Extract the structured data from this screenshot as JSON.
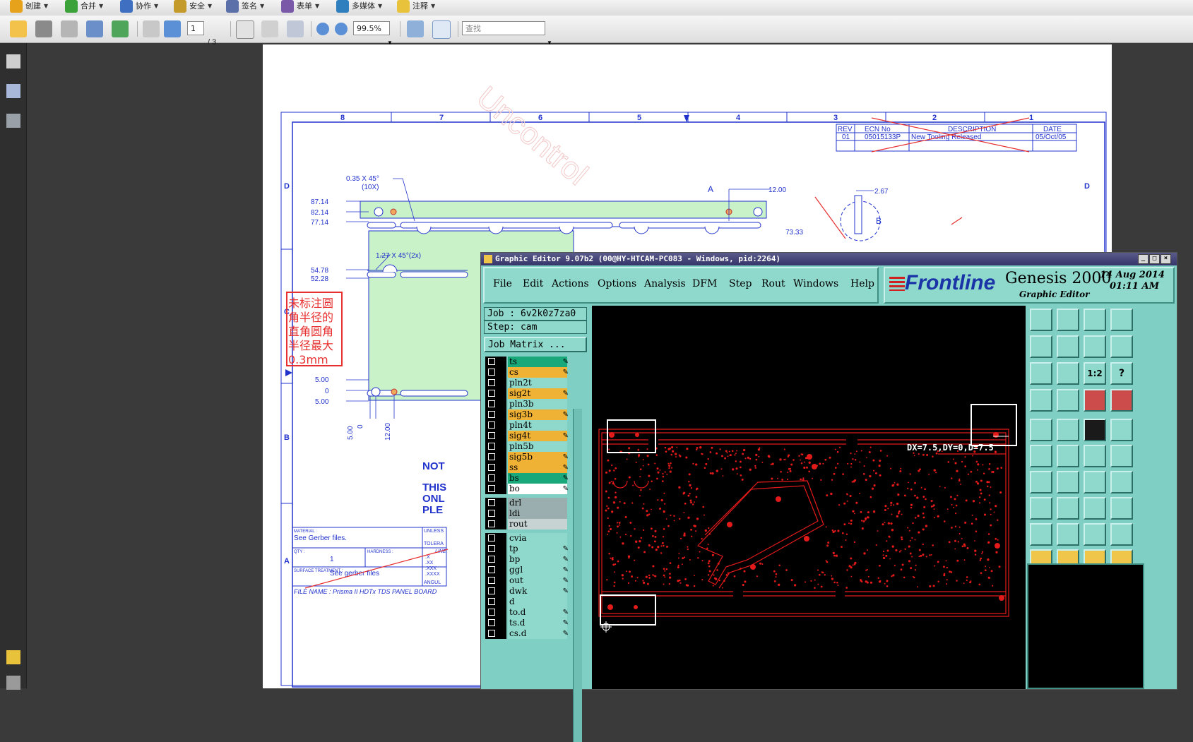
{
  "menubar": {
    "items": [
      {
        "label": "创建",
        "icon": "create-icon",
        "color": "#e7a21b"
      },
      {
        "label": "合并",
        "icon": "combine-icon",
        "color": "#3aa238"
      },
      {
        "label": "协作",
        "icon": "collaborate-icon",
        "color": "#3f6fc0"
      },
      {
        "label": "安全",
        "icon": "lock-icon",
        "color": "#c49a2b"
      },
      {
        "label": "签名",
        "icon": "pen-icon",
        "color": "#5b6fa8"
      },
      {
        "label": "表单",
        "icon": "form-icon",
        "color": "#7a5aa8"
      },
      {
        "label": "多媒体",
        "icon": "film-icon",
        "color": "#2f7fbf"
      },
      {
        "label": "注释",
        "icon": "comment-icon",
        "color": "#e8c23a"
      }
    ]
  },
  "toolbar": {
    "page_current": "1",
    "page_total": "/ 3",
    "zoom": "99.5%",
    "search_placeholder": "查找"
  },
  "drawing": {
    "col_labels": [
      "8",
      "7",
      "6",
      "5",
      "4",
      "3",
      "2",
      "1"
    ],
    "row_labels": [
      "D",
      "C",
      "B",
      "A"
    ],
    "rev_header": [
      "REV",
      "ECN No",
      "DESCRIPTION",
      "DATE"
    ],
    "rev_row": [
      "01",
      "05015133P",
      "New Tooling Released",
      "05/Oct/05"
    ],
    "watermark": "Uncontrol",
    "dim_chamfer_top": "0.35 X 45°",
    "dim_chamfer_count": "(10X)",
    "dim_chamfer_side": "1.27 X 45°(2x)",
    "dims_left": [
      "87.14",
      "82.14",
      "77.14",
      "54.78",
      "52.28",
      "5.00",
      "0",
      "5.00"
    ],
    "dims_bottom": [
      "5.00",
      "0",
      "12.00"
    ],
    "dim_a": "A",
    "dim_1200": "12.00",
    "dim_267": "2.67",
    "dim_b": "B",
    "dim_7333": "73.33",
    "note_lines": [
      "未标注圆",
      "角半径的",
      "直角圆角",
      "半径最大",
      "0.3mm"
    ],
    "note_right": [
      "NOT",
      "THIS",
      "ONL",
      "PLE"
    ],
    "title_block": {
      "material_label": "MATERIAL :",
      "material": "See Gerber files.",
      "qty_label": "QTY :",
      "qty": "1",
      "hardness_label": "HARDNESS :",
      "surface_label": "SURFACE TREATMENT :",
      "surface": "See gerber files",
      "unless": "UNLESS",
      "tolera": "TOLERA",
      "line": "LINE",
      "x1": ".X",
      "x2": ".XX",
      "x3": ".XXX",
      "x4": ".XXXX",
      "angul": "ANGUL",
      "file_name": "FILE NAME : Prisma II HDTx TDS PANEL BOARD"
    }
  },
  "genesis": {
    "title": "Graphic Editor 9.07b2 (00@HY-HTCAM-PC083 - Windows, pid:2264)",
    "menu": [
      "File",
      "Edit",
      "Actions",
      "Options",
      "Analysis",
      "DFM",
      "Step",
      "Rout",
      "Windows",
      "Help"
    ],
    "brand": "Frontline",
    "product": "Genesis 2000",
    "subtitle": "Graphic Editor",
    "date": "14 Aug 2014",
    "time": "01:11 AM",
    "job": "Job : 6v2k0z7za0",
    "step": "Step: cam",
    "job_matrix": "Job Matrix ...",
    "layers": [
      {
        "name": "ts",
        "color": "#19a87a",
        "brush": true
      },
      {
        "name": "cs",
        "color": "#f0b235",
        "brush": true
      },
      {
        "name": "pln2t",
        "color": "#8fd8cc",
        "brush": false
      },
      {
        "name": "sig2t",
        "color": "#f0b235",
        "brush": true
      },
      {
        "name": "pln3b",
        "color": "#8fd8cc",
        "brush": false
      },
      {
        "name": "sig3b",
        "color": "#f0b235",
        "brush": true
      },
      {
        "name": "pln4t",
        "color": "#8fd8cc",
        "brush": false
      },
      {
        "name": "sig4t",
        "color": "#f0b235",
        "brush": true
      },
      {
        "name": "pln5b",
        "color": "#8fd8cc",
        "brush": false
      },
      {
        "name": "sig5b",
        "color": "#f0b235",
        "brush": true
      },
      {
        "name": "ss",
        "color": "#f0b235",
        "brush": true
      },
      {
        "name": "bs",
        "color": "#19a87a",
        "brush": true
      },
      {
        "name": "bo",
        "color": "#ffffff",
        "brush": true
      },
      {
        "name": "drl",
        "color": "#9aaeb0",
        "brush": false
      },
      {
        "name": "ldi",
        "color": "#9aaeb0",
        "brush": false
      },
      {
        "name": "rout",
        "color": "#c7d2d2",
        "brush": false
      },
      {
        "name": "cvia",
        "color": "#8fd8cc",
        "brush": false
      },
      {
        "name": "tp",
        "color": "#8fd8cc",
        "brush": true
      },
      {
        "name": "bp",
        "color": "#8fd8cc",
        "brush": true
      },
      {
        "name": "ggl",
        "color": "#8fd8cc",
        "brush": true
      },
      {
        "name": "out",
        "color": "#8fd8cc",
        "brush": true
      },
      {
        "name": "dwk",
        "color": "#8fd8cc",
        "brush": true
      },
      {
        "name": "d",
        "color": "#8fd8cc",
        "brush": false
      },
      {
        "name": "to.d",
        "color": "#8fd8cc",
        "brush": true
      },
      {
        "name": "ts.d",
        "color": "#8fd8cc",
        "brush": true
      },
      {
        "name": "cs.d",
        "color": "#8fd8cc",
        "brush": true
      }
    ],
    "measure": "DX=7.5,DY=0,D=7.5",
    "tool_1to2": "1:2",
    "tool_help": "?"
  }
}
